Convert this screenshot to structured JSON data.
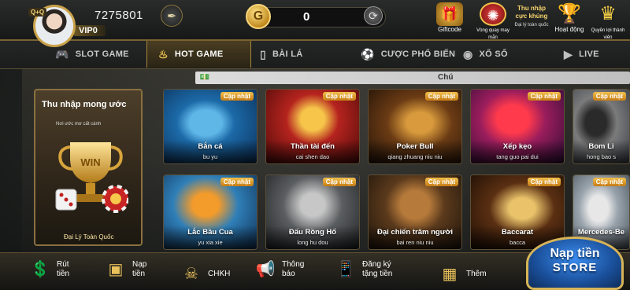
{
  "header": {
    "vip_small": "Q+Q",
    "vip_label": "VIP0",
    "balance": "7275801",
    "coin_symbol": "G",
    "coin_value": "0",
    "icons": [
      {
        "name": "giftcode",
        "label": "Giftcode"
      },
      {
        "name": "spin",
        "label": "Vòng quay may mắn"
      },
      {
        "name": "income",
        "label_main": "Thu nhập cực khủng",
        "label_sub": "Đại lý toàn quốc"
      },
      {
        "name": "trophy",
        "label": "Hoạt động"
      },
      {
        "name": "crown",
        "label": "Quyền lợi thành viên"
      }
    ]
  },
  "tabs": [
    {
      "label": "SLOT GAME",
      "icon": "gamepad-icon"
    },
    {
      "label": "HOT GAME",
      "icon": "fire-icon",
      "active": true
    },
    {
      "label": "BÀI LÁ",
      "icon": "cards-icon"
    },
    {
      "label": "CƯỢC PHỔ BIẾN",
      "icon": "ball-icon"
    },
    {
      "label": "XỔ SỐ",
      "icon": "lottery-icon"
    },
    {
      "label": "LIVE",
      "icon": "play-icon"
    }
  ],
  "ticker": {
    "text": "Chú"
  },
  "promo": {
    "title": "Thu nhập mong ước",
    "subtitle": "Nơi ước mơ cất cánh",
    "footer": "Đại Lý Toàn Quốc",
    "trophy_text": "WIN"
  },
  "badge_text": "Cập nhật",
  "games": [
    {
      "name": "Bắn cá",
      "sub": "bu yu",
      "theme": "fish"
    },
    {
      "name": "Thần tài đến",
      "sub": "cai shen dao",
      "theme": "wealth"
    },
    {
      "name": "Poker Bull",
      "sub": "qiang zhuang niu niu",
      "theme": "bull"
    },
    {
      "name": "Xếp kẹo",
      "sub": "tang guo pai dui",
      "theme": "candy"
    },
    {
      "name": "Bom Li",
      "sub": "hong bao s",
      "theme": "bomb"
    },
    {
      "name": "Lắc Bầu Cua",
      "sub": "yu xia xie",
      "theme": "crab"
    },
    {
      "name": "Đấu Rồng Hổ",
      "sub": "long hu dou",
      "theme": "dragon"
    },
    {
      "name": "Đại chiến trâm người",
      "sub": "bai ren niu niu",
      "theme": "cowboy"
    },
    {
      "name": "Baccarat",
      "sub": "bacca",
      "theme": "baccarat"
    },
    {
      "name": "Mercedes-Be",
      "sub": "",
      "theme": "car"
    }
  ],
  "bottom": [
    {
      "label_1": "Rút",
      "label_2": "tiền",
      "icon": "withdraw-icon"
    },
    {
      "label_1": "Nạp",
      "label_2": "tiền",
      "icon": "treasure-icon"
    },
    {
      "label_1": "CHKH",
      "label_2": "",
      "icon": "support-icon"
    },
    {
      "label_1": "Thông",
      "label_2": "báo",
      "icon": "megaphone-icon"
    },
    {
      "label_1": "Đăng ký",
      "label_2": "tặng tiền",
      "icon": "phone-gift-icon"
    },
    {
      "label_1": "Thêm",
      "label_2": "",
      "icon": "more-icon"
    }
  ],
  "nap_store": {
    "line1": "Nạp tiền",
    "line2": "STORE"
  },
  "colors": {
    "gold": "#caa24a",
    "badge": "#f2c04d",
    "store_blue": "#1a4f9a"
  }
}
